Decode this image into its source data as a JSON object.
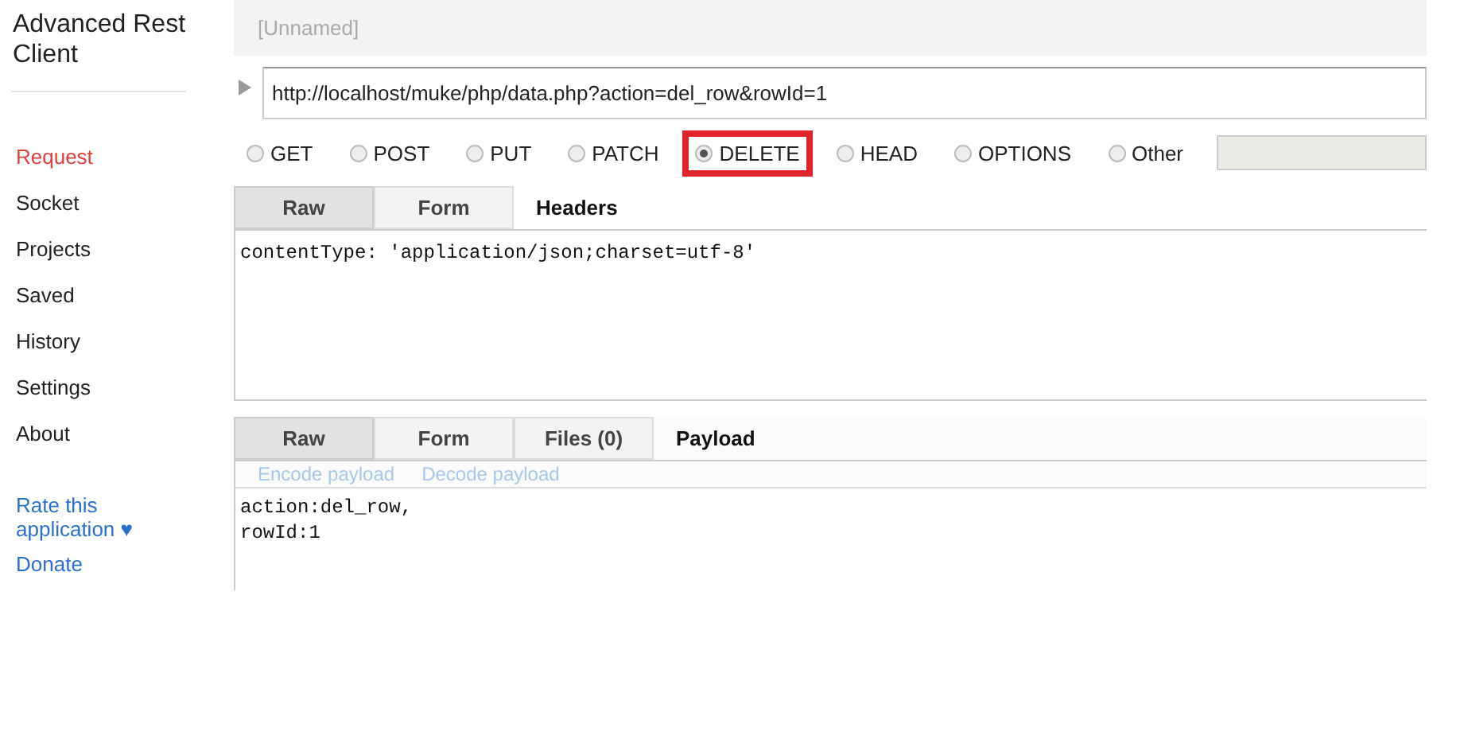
{
  "sidebar": {
    "title": "Advanced Rest Client",
    "items": [
      {
        "label": "Request",
        "selected": true
      },
      {
        "label": "Socket",
        "selected": false
      },
      {
        "label": "Projects",
        "selected": false
      },
      {
        "label": "Saved",
        "selected": false
      },
      {
        "label": "History",
        "selected": false
      },
      {
        "label": "Settings",
        "selected": false
      },
      {
        "label": "About",
        "selected": false
      }
    ],
    "links": [
      {
        "label": "Rate this application ♥"
      },
      {
        "label": "Donate"
      }
    ]
  },
  "request": {
    "name": "[Unnamed]",
    "url": "http://localhost/muke/php/data.php?action=del_row&rowId=1",
    "methods": [
      {
        "label": "GET",
        "selected": false,
        "highlighted": false
      },
      {
        "label": "POST",
        "selected": false,
        "highlighted": false
      },
      {
        "label": "PUT",
        "selected": false,
        "highlighted": false
      },
      {
        "label": "PATCH",
        "selected": false,
        "highlighted": false
      },
      {
        "label": "DELETE",
        "selected": true,
        "highlighted": true
      },
      {
        "label": "HEAD",
        "selected": false,
        "highlighted": false
      },
      {
        "label": "OPTIONS",
        "selected": false,
        "highlighted": false
      },
      {
        "label": "Other",
        "selected": false,
        "highlighted": false
      }
    ]
  },
  "headers": {
    "tabs": [
      {
        "label": "Raw",
        "selected": true
      },
      {
        "label": "Form",
        "selected": false
      }
    ],
    "heading": "Headers",
    "body": [
      "contentType: 'application/json;charset=utf-8'"
    ]
  },
  "payload": {
    "tabs": [
      {
        "label": "Raw",
        "selected": true
      },
      {
        "label": "Form",
        "selected": false
      },
      {
        "label": "Files (0)",
        "selected": false
      }
    ],
    "heading": "Payload",
    "actions": [
      "Encode payload",
      "Decode payload"
    ],
    "body": [
      "action:del_row,",
      "rowId:1"
    ]
  }
}
